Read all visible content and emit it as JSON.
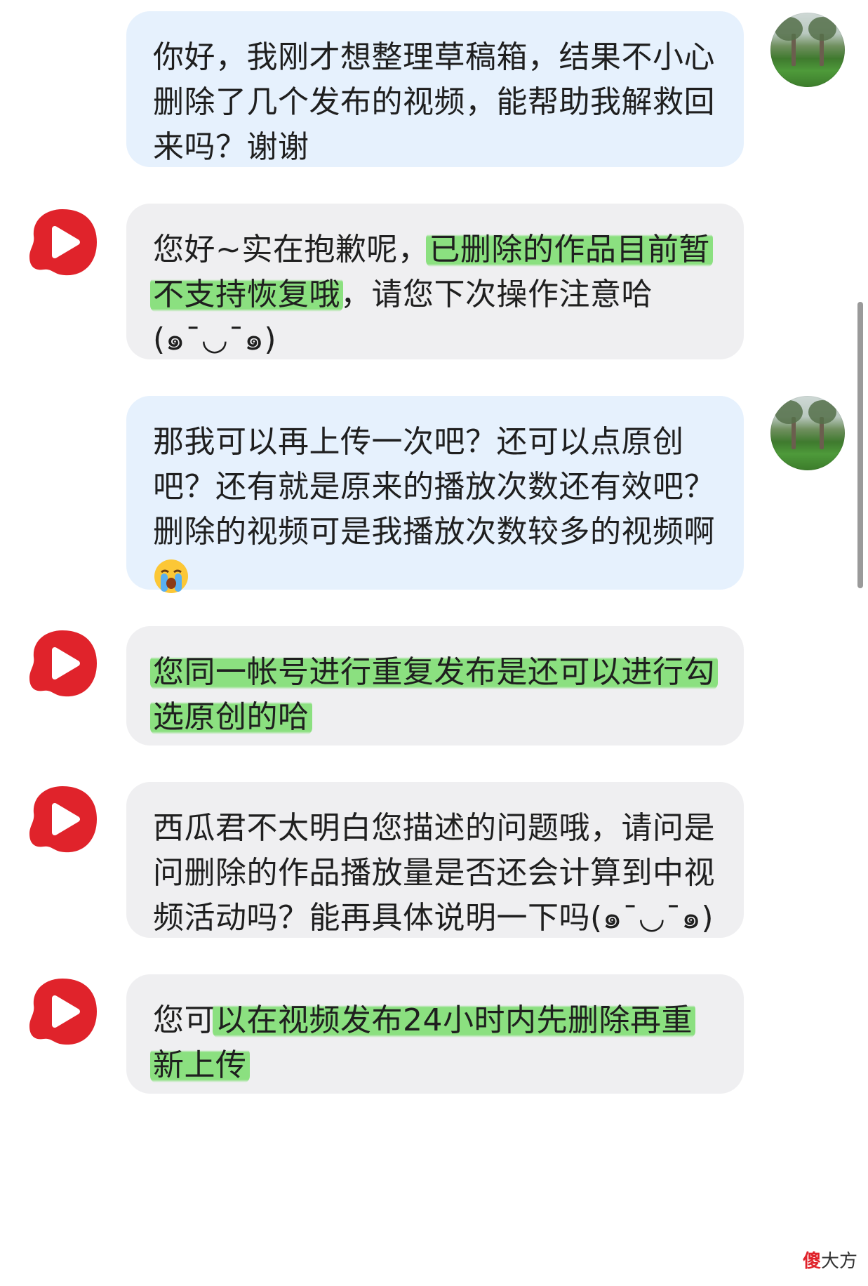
{
  "messages": [
    {
      "sender": "user",
      "lines": [
        "你好，我刚才想整理草稿箱，结果不小心",
        "删除了几个发布的视频，能帮助我解救回",
        "来吗？谢谢"
      ]
    },
    {
      "sender": "support",
      "l1a": "您好~实在抱歉呢，",
      "l1b": "已删除的作品目前暂",
      "l2a": "不支持恢复哦",
      "l2b": "，请您下次操作注意哈",
      "l3": "(๑¯◡¯๑)"
    },
    {
      "sender": "user",
      "lines": [
        "那我可以再上传一次吧？还可以点原创",
        "吧？还有就是原来的播放次数还有效吧？",
        "删除的视频可是我播放次数较多的视频啊"
      ],
      "emoji": "crying-face-emoji"
    },
    {
      "sender": "support",
      "l1": "您同一帐号进行重复发布是还可以进行勾",
      "l2": "选原创的哈"
    },
    {
      "sender": "support",
      "lines": [
        "西瓜君不太明白您描述的问题哦，请问是",
        "问删除的作品播放量是否还会计算到中视",
        "频活动吗？能再具体说明一下吗(๑¯◡¯๑)"
      ]
    },
    {
      "sender": "support",
      "l1a": "您可",
      "l1b": "以在视频发布24小时内先删除再重",
      "l2": "新上传"
    }
  ],
  "watermark": {
    "icon_char": "傻",
    "text": "大方"
  },
  "colors": {
    "user_bubble": "#e6f1fd",
    "support_bubble": "#efeff1",
    "highlight": "#7dde70",
    "app_logo": "#e0232b"
  }
}
